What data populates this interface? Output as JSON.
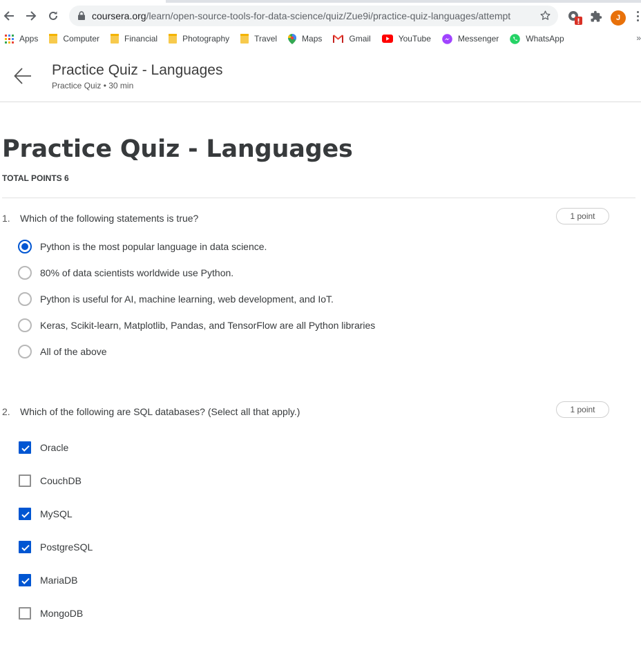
{
  "browser": {
    "url_host": "coursera.org",
    "url_path": "/learn/open-source-tools-for-data-science/quiz/Zue9i/practice-quiz-languages/attempt",
    "profile_initial": "J"
  },
  "bookmarks": [
    {
      "label": "Apps",
      "icon": "apps-grid-icon"
    },
    {
      "label": "Computer",
      "icon": "folder-icon"
    },
    {
      "label": "Financial",
      "icon": "folder-icon"
    },
    {
      "label": "Photography",
      "icon": "folder-icon"
    },
    {
      "label": "Travel",
      "icon": "folder-icon"
    },
    {
      "label": "Maps",
      "icon": "maps-pin-icon"
    },
    {
      "label": "Gmail",
      "icon": "gmail-icon"
    },
    {
      "label": "YouTube",
      "icon": "youtube-icon"
    },
    {
      "label": "Messenger",
      "icon": "messenger-icon"
    },
    {
      "label": "WhatsApp",
      "icon": "whatsapp-icon"
    }
  ],
  "bookmarks_overflow": "»",
  "header": {
    "title": "Practice Quiz - Languages",
    "subtitle": "Practice Quiz • 30 min"
  },
  "quiz": {
    "title": "Practice Quiz - Languages",
    "total_points": "TOTAL POINTS 6",
    "questions": [
      {
        "number": "1.",
        "text": "Which of the following statements is true?",
        "points": "1 point",
        "type": "radio",
        "options": [
          {
            "label": "Python is the most popular language in data science.",
            "selected": true
          },
          {
            "label": "80% of data scientists worldwide use Python.",
            "selected": false
          },
          {
            "label": "Python is useful for AI, machine learning, web development, and IoT.",
            "selected": false
          },
          {
            "label": "Keras, Scikit-learn, Matplotlib, Pandas, and TensorFlow are all Python libraries",
            "selected": false
          },
          {
            "label": "All of the above",
            "selected": false
          }
        ]
      },
      {
        "number": "2.",
        "text": "Which of the following are SQL databases? (Select all that apply.)",
        "points": "1 point",
        "type": "checkbox",
        "options": [
          {
            "label": "Oracle",
            "checked": true
          },
          {
            "label": "CouchDB",
            "checked": false
          },
          {
            "label": "MySQL",
            "checked": true
          },
          {
            "label": "PostgreSQL",
            "checked": true
          },
          {
            "label": "MariaDB",
            "checked": true
          },
          {
            "label": "MongoDB",
            "checked": false
          }
        ]
      }
    ]
  },
  "colors": {
    "accent": "#0056d2",
    "title_text": "#373a3c"
  }
}
